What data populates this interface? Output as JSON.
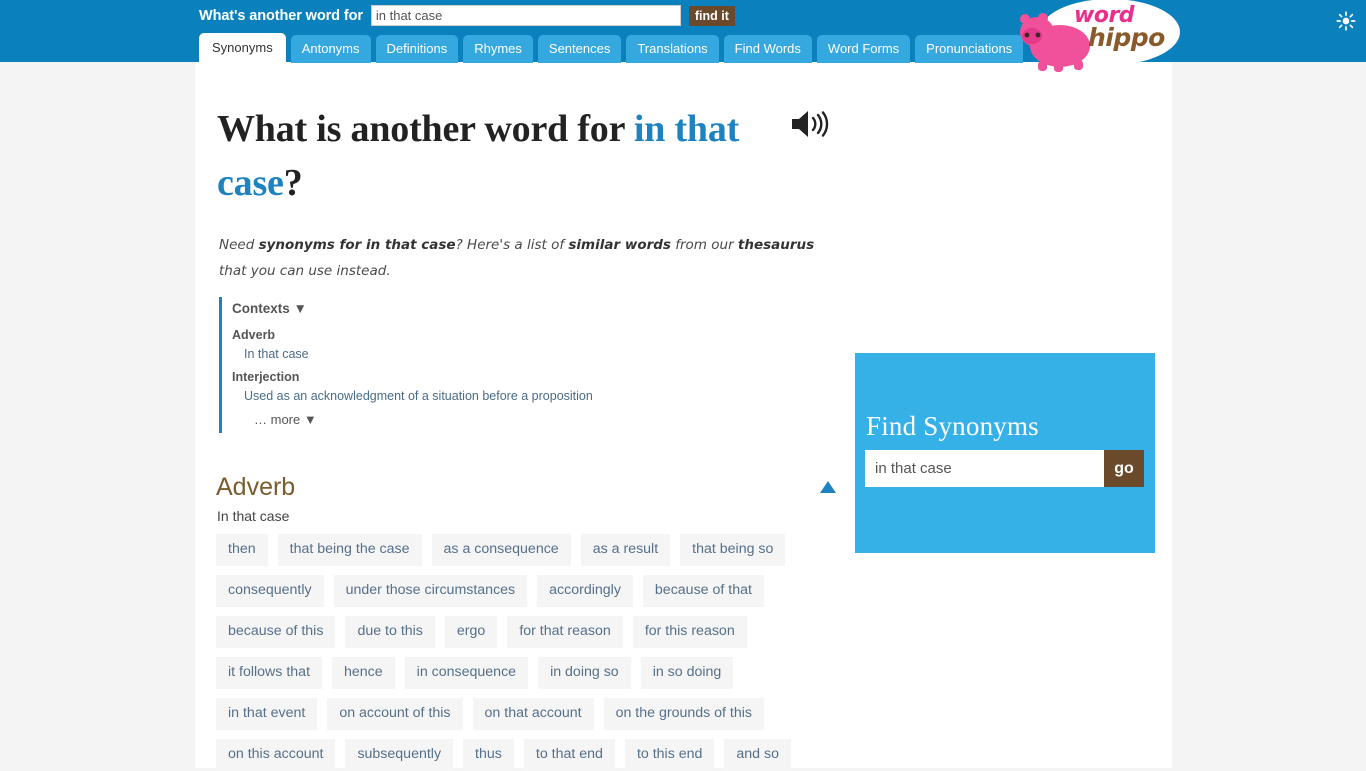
{
  "header": {
    "search_label": "What's another word for",
    "search_value": "in that case",
    "search_placeholder": "",
    "find_button": "find it",
    "sun_icon": "sun-icon",
    "tabs": [
      {
        "label": "Synonyms",
        "active": true
      },
      {
        "label": "Antonyms",
        "active": false
      },
      {
        "label": "Definitions",
        "active": false
      },
      {
        "label": "Rhymes",
        "active": false
      },
      {
        "label": "Sentences",
        "active": false
      },
      {
        "label": "Translations",
        "active": false
      },
      {
        "label": "Find Words",
        "active": false
      },
      {
        "label": "Word Forms",
        "active": false
      },
      {
        "label": "Pronunciations",
        "active": false
      }
    ]
  },
  "logo": {
    "word": "word",
    "hippo": "hippo",
    "word_color": "#e8308a",
    "hippo_color": "#8a5a2b",
    "mascot": "hippo-mascot-icon"
  },
  "main": {
    "heading_prefix": "What is another word for ",
    "heading_term": "in that case",
    "heading_suffix": "?",
    "speaker_icon": "speaker-icon",
    "lead_parts": [
      {
        "text": "Need ",
        "bold": false
      },
      {
        "text": "synonyms for in that case",
        "bold": true
      },
      {
        "text": "? Here's a list of ",
        "bold": false
      },
      {
        "text": "similar words",
        "bold": true
      },
      {
        "text": " from our ",
        "bold": false
      },
      {
        "text": "thesaurus",
        "bold": true
      },
      {
        "text": " that you can use instead.",
        "bold": false
      }
    ],
    "contexts": {
      "title": "Contexts",
      "title_caret": "▼",
      "entries": [
        {
          "pos": "Adverb",
          "sense": "In that case"
        },
        {
          "pos": "Interjection",
          "sense": "Used as an acknowledgment of a situation before a proposition"
        }
      ],
      "more_label": "… more ▼"
    },
    "group": {
      "title": "Adverb",
      "sense": "In that case",
      "collapse_icon": "collapse-triangle-up-icon",
      "chips": [
        "then",
        "that being the case",
        "as a consequence",
        "as a result",
        "that being so",
        "consequently",
        "under those circumstances",
        "accordingly",
        "because of that",
        "because of this",
        "due to this",
        "ergo",
        "for that reason",
        "for this reason",
        "it follows that",
        "hence",
        "in consequence",
        "in doing so",
        "in so doing",
        "in that event",
        "on account of this",
        "on that account",
        "on the grounds of this",
        "on this account",
        "subsequently",
        "thus",
        "to that end",
        "to this end",
        "and so"
      ]
    }
  },
  "sidebar": {
    "find_title": "Find Synonyms",
    "find_value": "in that case",
    "find_placeholder": "",
    "go_label": "go",
    "box_color": "#36b1e8"
  },
  "colors": {
    "topbar": "#0a80bd",
    "tab": "#36a8e0",
    "accent_blue": "#1f82c0",
    "brown": "#6b4a2b",
    "chip_bg": "#f5f5f5",
    "chip_text": "#56708a",
    "page_bg": "#f4f4f4"
  }
}
